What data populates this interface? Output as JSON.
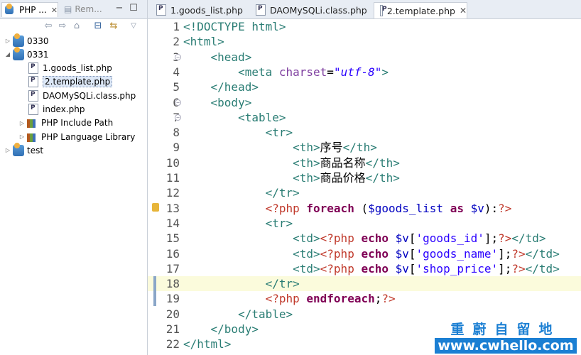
{
  "explorer": {
    "tab_php": "PHP ...",
    "tab_remote": "Rem...",
    "tree": [
      {
        "label": "0330",
        "depth": 0,
        "type": "project",
        "expanded": false
      },
      {
        "label": "0331",
        "depth": 0,
        "type": "project",
        "expanded": true
      },
      {
        "label": "1.goods_list.php",
        "depth": 1,
        "type": "php"
      },
      {
        "label": "2.template.php",
        "depth": 1,
        "type": "php",
        "selected": true
      },
      {
        "label": "DAOMySQLi.class.php",
        "depth": 1,
        "type": "php"
      },
      {
        "label": "index.php",
        "depth": 1,
        "type": "php"
      },
      {
        "label": "PHP Include Path",
        "depth": 1,
        "type": "lib"
      },
      {
        "label": "PHP Language Library",
        "depth": 1,
        "type": "lib"
      },
      {
        "label": "test",
        "depth": 0,
        "type": "project",
        "expanded": false
      }
    ]
  },
  "editor": {
    "tabs": [
      {
        "label": "1.goods_list.php"
      },
      {
        "label": "DAOMySQLi.class.php"
      },
      {
        "label": "2.template.php",
        "active": true
      }
    ],
    "highlighted_line": 18,
    "lines": [
      {
        "n": "1",
        "segs": [
          [
            "tag",
            "<!DOCTYPE html>"
          ]
        ]
      },
      {
        "n": "2",
        "segs": [
          [
            "tag",
            "<html>"
          ]
        ]
      },
      {
        "n": "3",
        "fold": true,
        "segs": [
          [
            "plain",
            "    "
          ],
          [
            "tag",
            "<head>"
          ]
        ]
      },
      {
        "n": "4",
        "segs": [
          [
            "plain",
            "        "
          ],
          [
            "tag",
            "<meta "
          ],
          [
            "attr",
            "charset"
          ],
          [
            "plain",
            "="
          ],
          [
            "str",
            "\"utf-8\""
          ],
          [
            "tag",
            ">"
          ]
        ]
      },
      {
        "n": "5",
        "segs": [
          [
            "plain",
            "    "
          ],
          [
            "tag",
            "</head>"
          ]
        ]
      },
      {
        "n": "6",
        "fold": true,
        "segs": [
          [
            "plain",
            "    "
          ],
          [
            "tag",
            "<body>"
          ]
        ]
      },
      {
        "n": "7",
        "fold": true,
        "segs": [
          [
            "plain",
            "        "
          ],
          [
            "tag",
            "<table>"
          ]
        ]
      },
      {
        "n": "8",
        "segs": [
          [
            "plain",
            "            "
          ],
          [
            "tag",
            "<tr>"
          ]
        ]
      },
      {
        "n": "9",
        "segs": [
          [
            "plain",
            "                "
          ],
          [
            "tag",
            "<th>"
          ],
          [
            "plain",
            "序号"
          ],
          [
            "tag",
            "</th>"
          ]
        ]
      },
      {
        "n": "10",
        "segs": [
          [
            "plain",
            "                "
          ],
          [
            "tag",
            "<th>"
          ],
          [
            "plain",
            "商品名称"
          ],
          [
            "tag",
            "</th>"
          ]
        ]
      },
      {
        "n": "11",
        "segs": [
          [
            "plain",
            "                "
          ],
          [
            "tag",
            "<th>"
          ],
          [
            "plain",
            "商品价格"
          ],
          [
            "tag",
            "</th>"
          ]
        ]
      },
      {
        "n": "12",
        "segs": [
          [
            "plain",
            "            "
          ],
          [
            "tag",
            "</tr>"
          ]
        ]
      },
      {
        "n": "13",
        "warn": true,
        "segs": [
          [
            "plain",
            "            "
          ],
          [
            "php",
            "<?php "
          ],
          [
            "kw",
            "foreach"
          ],
          [
            "plain",
            " ("
          ],
          [
            "var",
            "$goods_list"
          ],
          [
            "plain",
            " "
          ],
          [
            "kw",
            "as"
          ],
          [
            "plain",
            " "
          ],
          [
            "var",
            "$v"
          ],
          [
            "plain",
            "):"
          ],
          [
            "php",
            "?>"
          ]
        ]
      },
      {
        "n": "14",
        "segs": [
          [
            "plain",
            "            "
          ],
          [
            "tag",
            "<tr>"
          ]
        ]
      },
      {
        "n": "15",
        "segs": [
          [
            "plain",
            "                "
          ],
          [
            "tag",
            "<td>"
          ],
          [
            "php",
            "<?php "
          ],
          [
            "kw",
            "echo"
          ],
          [
            "plain",
            " "
          ],
          [
            "var",
            "$v"
          ],
          [
            "plain",
            "["
          ],
          [
            "sq",
            "'goods_id'"
          ],
          [
            "plain",
            "];"
          ],
          [
            "php",
            "?>"
          ],
          [
            "tag",
            "</td>"
          ]
        ]
      },
      {
        "n": "16",
        "segs": [
          [
            "plain",
            "                "
          ],
          [
            "tag",
            "<td>"
          ],
          [
            "php",
            "<?php "
          ],
          [
            "kw",
            "echo"
          ],
          [
            "plain",
            " "
          ],
          [
            "var",
            "$v"
          ],
          [
            "plain",
            "["
          ],
          [
            "sq",
            "'goods_name'"
          ],
          [
            "plain",
            "];"
          ],
          [
            "php",
            "?>"
          ],
          [
            "tag",
            "</td>"
          ]
        ]
      },
      {
        "n": "17",
        "segs": [
          [
            "plain",
            "                "
          ],
          [
            "tag",
            "<td>"
          ],
          [
            "php",
            "<?php "
          ],
          [
            "kw",
            "echo"
          ],
          [
            "plain",
            " "
          ],
          [
            "var",
            "$v"
          ],
          [
            "plain",
            "["
          ],
          [
            "sq",
            "'shop_price'"
          ],
          [
            "plain",
            "];"
          ],
          [
            "php",
            "?>"
          ],
          [
            "tag",
            "</td>"
          ]
        ]
      },
      {
        "n": "18",
        "bm": true,
        "segs": [
          [
            "plain",
            "            "
          ],
          [
            "tag",
            "</tr>"
          ]
        ]
      },
      {
        "n": "19",
        "bm": true,
        "segs": [
          [
            "plain",
            "            "
          ],
          [
            "php",
            "<?php "
          ],
          [
            "kw",
            "endforeach"
          ],
          [
            "plain",
            ";"
          ],
          [
            "php",
            "?>"
          ]
        ]
      },
      {
        "n": "20",
        "segs": [
          [
            "plain",
            "        "
          ],
          [
            "tag",
            "</table>"
          ]
        ]
      },
      {
        "n": "21",
        "segs": [
          [
            "plain",
            "    "
          ],
          [
            "tag",
            "</body>"
          ]
        ]
      },
      {
        "n": "22",
        "segs": [
          [
            "tag",
            "</html>"
          ]
        ]
      }
    ]
  },
  "watermark": {
    "line1": "重蔚自留地",
    "line2": "www.cwhello.com"
  }
}
